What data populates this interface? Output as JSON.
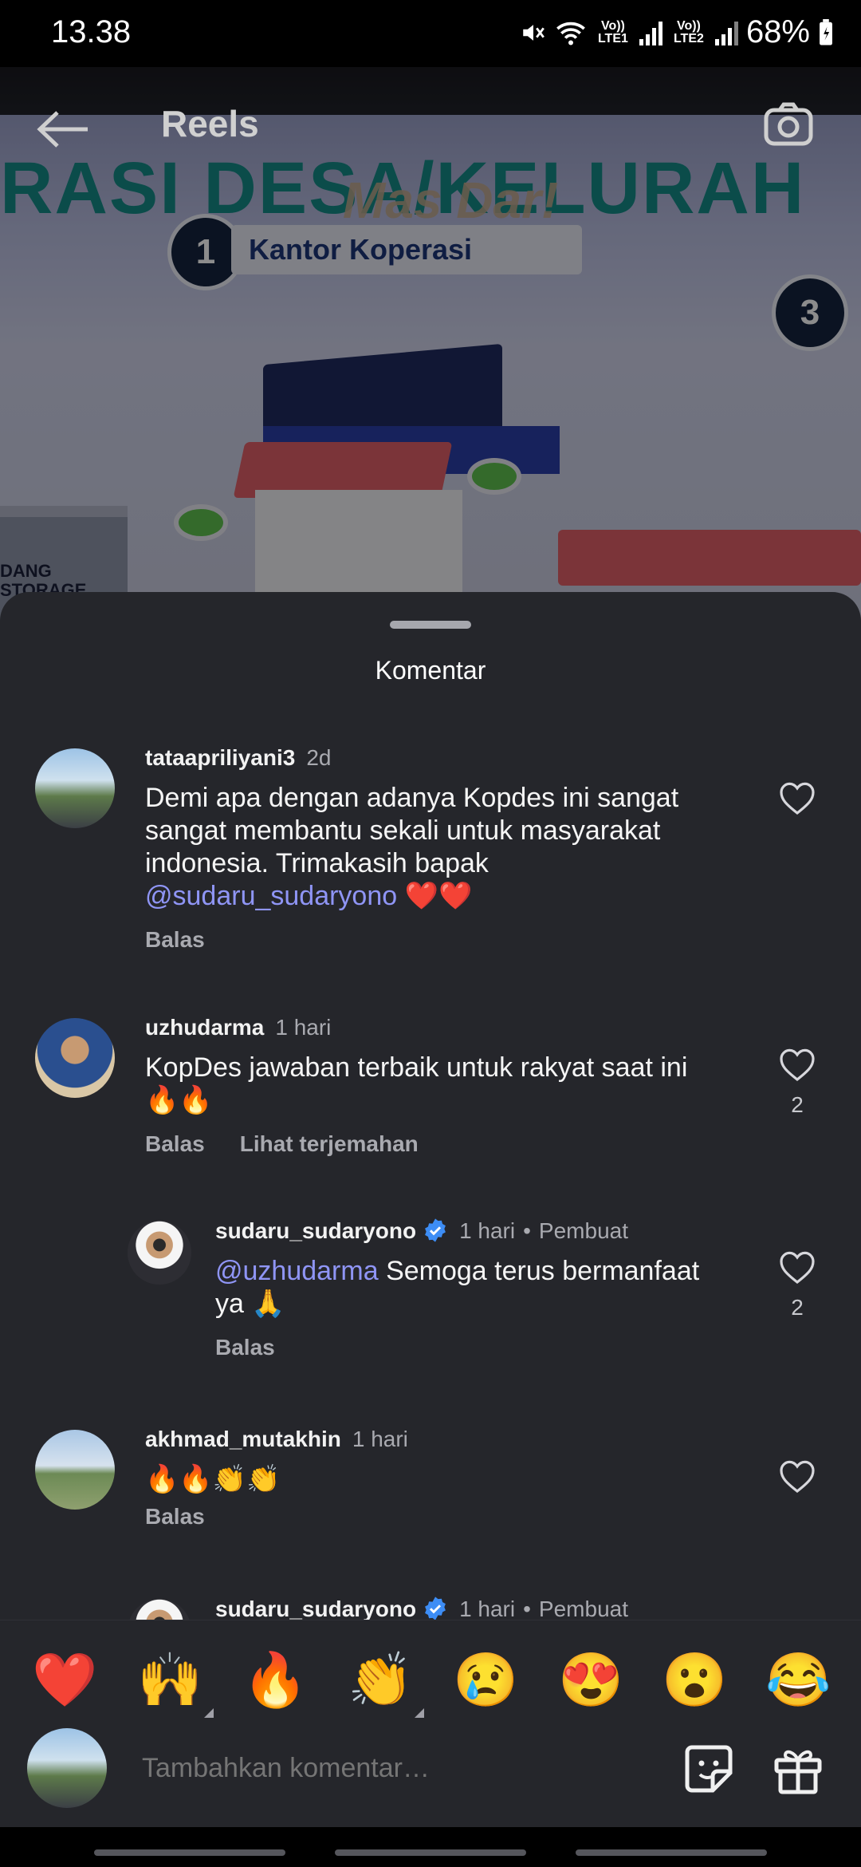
{
  "status_bar": {
    "time": "13.38",
    "sim1": "Vo)) LTE1",
    "sim2": "Vo)) LTE2",
    "battery": "68%"
  },
  "header": {
    "title": "Reels",
    "back_icon": "back-arrow-icon",
    "camera_icon": "camera-icon"
  },
  "video": {
    "banner": "RASI DESA/KELURAH",
    "watermark": "Mas Dar!",
    "station_label": "Kantor Koperasi",
    "step_one": "1",
    "step_three": "3",
    "storage_label": "DANG STORAGE"
  },
  "sheet": {
    "title": "Komentar"
  },
  "comments": [
    {
      "username": "tataapriliyani3",
      "time": "2d",
      "text": "Demi apa dengan adanya Kopdes ini sangat sangat membantu sekali untuk masyarakat indonesia. Trimakasih bapak ",
      "mention": "@sudaru_sudaryono",
      "emojis": "❤️❤️",
      "reply": "Balas"
    },
    {
      "username": "uzhudarma",
      "time": "1 hari",
      "text": "KopDes jawaban terbaik untuk rakyat saat ini",
      "emojis": "🔥🔥",
      "reply": "Balas",
      "translate": "Lihat terjemahan",
      "likes": "2"
    },
    {
      "username": "sudaru_sudaryono",
      "time": "1 hari",
      "creator": "Pembuat",
      "mention": "@uzhudarma",
      "text": " Semoga terus bermanfaat ya ",
      "emojis": "🙏",
      "reply": "Balas",
      "likes": "2"
    },
    {
      "username": "akhmad_mutakhin",
      "time": "1 hari",
      "emojis": "🔥🔥👏👏",
      "reply": "Balas"
    },
    {
      "username": "sudaru_sudaryono",
      "time": "1 hari",
      "creator": "Pembuat"
    }
  ],
  "emoji_bar": [
    "❤️",
    "🙌",
    "🔥",
    "👏",
    "😢",
    "😍",
    "😮",
    "😂"
  ],
  "composer": {
    "placeholder": "Tambahkan komentar…",
    "sticker_icon": "sticker-icon",
    "gift_icon": "gift-icon"
  },
  "colors": {
    "sheet_bg": "#25262b",
    "mention": "#8f95f5",
    "meta": "#a9aab0"
  }
}
